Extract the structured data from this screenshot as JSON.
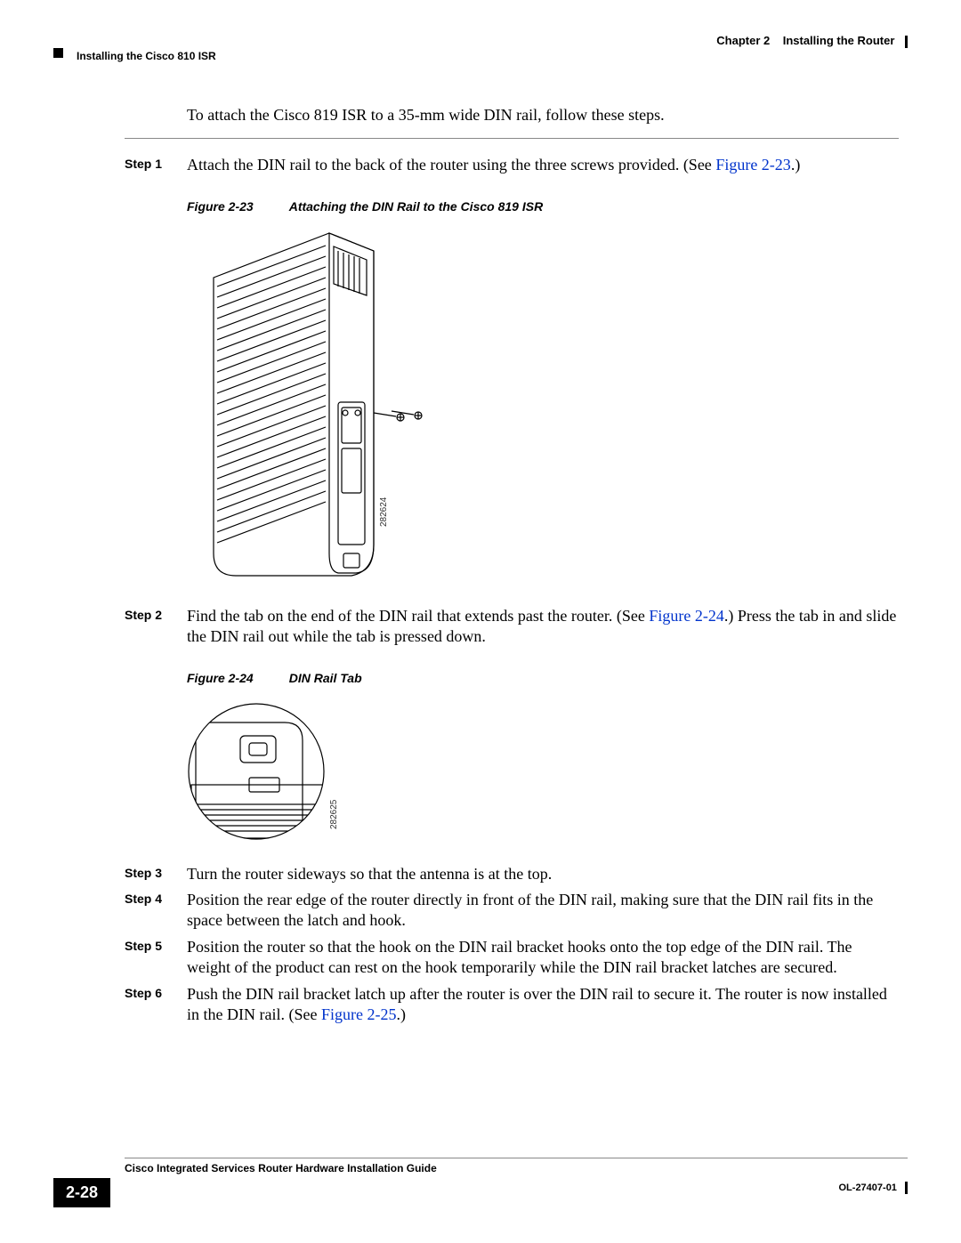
{
  "header": {
    "chapter_label": "Chapter 2",
    "chapter_title": "Installing the Router",
    "section_title": "Installing the Cisco 810 ISR"
  },
  "intro": "To attach the Cisco 819 ISR to a 35-mm wide DIN rail, follow these steps.",
  "steps": [
    {
      "label": "Step 1",
      "text_before": "Attach the DIN rail to the back of the router using the three screws provided. (See ",
      "link": "Figure 2-23",
      "text_after": ".)"
    },
    {
      "label": "Step 2",
      "text_before": "Find the tab on the end of the DIN rail that extends past the router. (See ",
      "link": "Figure 2-24",
      "text_after": ".) Press the tab in and slide the DIN rail out while the tab is pressed down."
    },
    {
      "label": "Step 3",
      "text": "Turn the router sideways so that the antenna is at the top."
    },
    {
      "label": "Step 4",
      "text": "Position the rear edge of the router directly in front of the DIN rail, making sure that the DIN rail fits in the space between the latch and hook."
    },
    {
      "label": "Step 5",
      "text": "Position the router so that the hook on the DIN rail bracket hooks onto the top edge of the DIN rail. The weight of the product can rest on the hook temporarily while the DIN rail bracket latches are secured."
    },
    {
      "label": "Step 6",
      "text_before": "Push the DIN rail bracket latch up after the router is over the DIN rail to secure it. The router is now installed in the DIN rail. (See ",
      "link": "Figure 2-25",
      "text_after": ".)"
    }
  ],
  "figures": {
    "f23": {
      "number": "Figure 2-23",
      "title": "Attaching the DIN Rail to the Cisco 819 ISR",
      "image_id": "282624"
    },
    "f24": {
      "number": "Figure 2-24",
      "title": "DIN Rail Tab",
      "image_id": "282625"
    }
  },
  "footer": {
    "guide_title": "Cisco Integrated Services Router Hardware Installation Guide",
    "page_number": "2-28",
    "doc_id": "OL-27407-01"
  }
}
